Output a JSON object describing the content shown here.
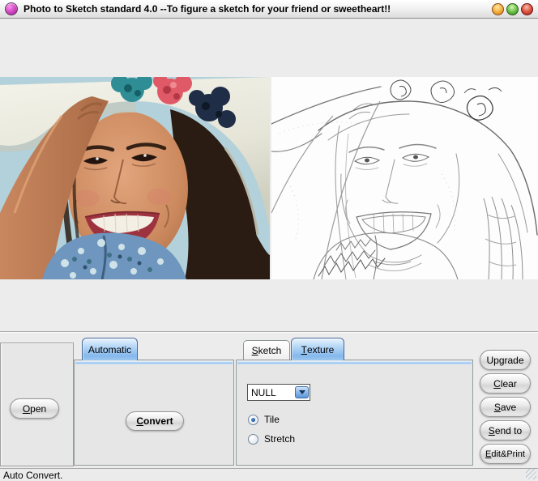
{
  "window": {
    "title": "Photo to Sketch standard 4.0 --To figure a sketch for your friend or sweetheart!!",
    "controls": [
      {
        "name": "minimize",
        "color": "#f6b13f"
      },
      {
        "name": "maximize",
        "color": "#6cc44c"
      },
      {
        "name": "close",
        "color": "#dd5240"
      }
    ],
    "app_icon_color": "#d84fc9"
  },
  "controls_panel": {
    "open_button": {
      "key": "O",
      "rest": "pen"
    },
    "automatic_tab": {
      "label": "Automatic",
      "selected": true
    },
    "convert_button": {
      "key": "C",
      "rest": "onvert"
    },
    "sketch_tab": {
      "key": "S",
      "rest": "ketch",
      "selected": false
    },
    "texture_tab": {
      "key": "T",
      "rest": "exture",
      "selected": true
    },
    "texture_select_value": "NULL",
    "tile_radio": {
      "label": "Tile",
      "selected": true
    },
    "stretch_radio": {
      "label": "Stretch",
      "selected": false
    },
    "action_buttons": {
      "upgrade": {
        "key": "",
        "rest": "Upgrade"
      },
      "clear": {
        "key": "C",
        "rest": "lear"
      },
      "save": {
        "key": "S",
        "rest": "ave"
      },
      "send_to": {
        "key": "S",
        "rest": "end to"
      },
      "edit_print": {
        "key": "E",
        "rest": "dit&Print"
      }
    }
  },
  "status_bar": {
    "text": "Auto Convert."
  },
  "colors": {
    "selected_tab_blue": "#85b8ec",
    "tab_stripe_blue": "#8fc0ee",
    "combo_arrow_blue": "#5e96d6",
    "radio_dot_blue": "#16498c",
    "client_background": "#ececec",
    "photo_background_blue": "#b2d1da"
  }
}
